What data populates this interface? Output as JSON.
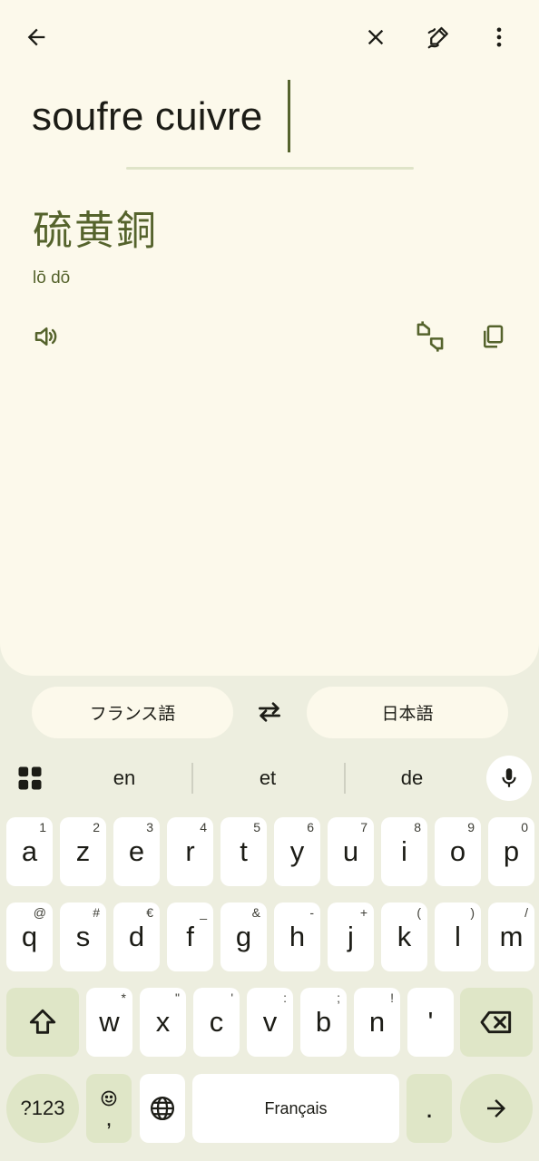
{
  "toolbar": {
    "back_icon": "arrow-back-icon",
    "clear_icon": "close-icon",
    "handwriting_icon": "handwriting-icon",
    "more_icon": "more-vert-icon"
  },
  "source": {
    "text": "soufre cuivre"
  },
  "result": {
    "translation": "硫黄銅",
    "romanization": "lō dō",
    "speak_icon": "volume-icon",
    "feedback_icon": "feedback-icon",
    "copy_icon": "copy-icon"
  },
  "languages": {
    "source": "フランス語",
    "target": "日本語",
    "swap_icon": "swap-icon"
  },
  "keyboard": {
    "suggestions": [
      "en",
      "et",
      "de"
    ],
    "row1": [
      {
        "key": "a",
        "hint": "1"
      },
      {
        "key": "z",
        "hint": "2"
      },
      {
        "key": "e",
        "hint": "3"
      },
      {
        "key": "r",
        "hint": "4"
      },
      {
        "key": "t",
        "hint": "5"
      },
      {
        "key": "y",
        "hint": "6"
      },
      {
        "key": "u",
        "hint": "7"
      },
      {
        "key": "i",
        "hint": "8"
      },
      {
        "key": "o",
        "hint": "9"
      },
      {
        "key": "p",
        "hint": "0"
      }
    ],
    "row2": [
      {
        "key": "q",
        "hint": "@"
      },
      {
        "key": "s",
        "hint": "#"
      },
      {
        "key": "d",
        "hint": "€"
      },
      {
        "key": "f",
        "hint": "_"
      },
      {
        "key": "g",
        "hint": "&"
      },
      {
        "key": "h",
        "hint": "-"
      },
      {
        "key": "j",
        "hint": "+"
      },
      {
        "key": "k",
        "hint": "("
      },
      {
        "key": "l",
        "hint": ")"
      },
      {
        "key": "m",
        "hint": "/"
      }
    ],
    "row3": [
      {
        "key": "w",
        "hint": "*"
      },
      {
        "key": "x",
        "hint": "\""
      },
      {
        "key": "c",
        "hint": "'"
      },
      {
        "key": "v",
        "hint": ":"
      },
      {
        "key": "b",
        "hint": ";"
      },
      {
        "key": "n",
        "hint": "!"
      },
      {
        "key": "'",
        "hint": ""
      }
    ],
    "symbols_label": "?123",
    "emoji_comma": ",",
    "space_label": "Français",
    "period_label": "."
  }
}
